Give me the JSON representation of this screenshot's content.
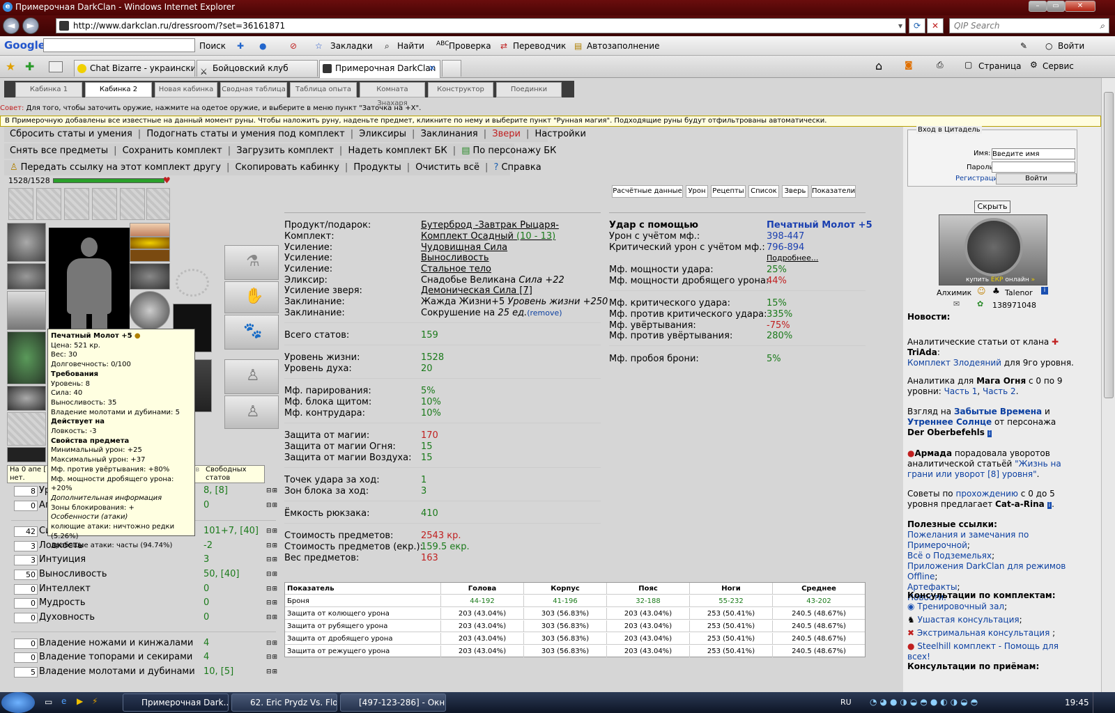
{
  "window": {
    "title": "Примерочная DarkClan - Windows Internet Explorer",
    "url": "http://www.darkclan.ru/dressroom/?set=36161871",
    "search_placeholder": "QIP Search"
  },
  "google_bar": {
    "logo": "Google",
    "search_btn": "Поиск",
    "bookmarks": "Закладки",
    "find": "Найти",
    "check": "Проверка",
    "translate": "Переводчик",
    "autofill": "Автозаполнение",
    "login": "Войти"
  },
  "tabs": [
    {
      "label": "Chat Bizarre - украинский..."
    },
    {
      "label": "Бойцовский клуб"
    },
    {
      "label": "Примерочная DarkClan"
    }
  ],
  "ie_tools": {
    "page": "Страница",
    "service": "Сервис"
  },
  "cab_tabs": [
    "Кабинка 1",
    "Кабинка 2",
    "Новая кабинка",
    "Сводная таблица",
    "Таблица опыта",
    "Комната Знахаря",
    "Конструктор",
    "Поединки"
  ],
  "tip1_label": "Совет:",
  "tip1": "Для того, чтобы заточить оружие, нажмите на одетое оружие, и выберите в меню пункт \"Заточка на +X\".",
  "tip2": "В Примерочную добавлены все известные на данный момент руны. Чтобы наложить руну, наденьте предмет, кликните по нему и выберите пункт \"Рунная магия\". Подходящие руны будут отфильтрованы автоматически.",
  "menu1": [
    "Сбросить статы и умения",
    "Подогнать статы и умения под комплект",
    "Эликсиры",
    "Заклинания",
    "Звери",
    "Настройки"
  ],
  "menu2": [
    "Снять все предметы",
    "Сохранить комплект",
    "Загрузить комплект",
    "Надеть комплект БК",
    "По персонажу БК"
  ],
  "menu3": [
    "Передать ссылку на этот комплект другу",
    "Скопировать кабинку",
    "Продукты",
    "Очистить всё",
    "Справка"
  ],
  "hp": "1528/1528",
  "tooltip": {
    "title": "Печатный Молот +5",
    "price": "Цена: 521 кр.",
    "weight": "Вес: 30",
    "durability": "Долговечность: 0/100",
    "req_h": "Требования",
    "req": [
      "Уровень: 8",
      "Сила: 40",
      "Выносливость: 35",
      "Владение молотами и дубинами: 5"
    ],
    "acts_h": "Действует на",
    "acts": [
      "Ловкость: -3"
    ],
    "props_h": "Свойства предмета",
    "props": [
      "Минимальный урон: +25",
      "Максимальный урон: +37",
      "Мф. против увёртывания: +80%",
      "Мф. мощности дробящего урона: +20%"
    ],
    "extra_h": "Дополнительная информация",
    "extra": [
      "Зоны блокирования: +",
      "Особенности (атаки)",
      "колющие атаки: ничтожно редки (5.26%)",
      "дробящие атаки: часты (94.74%)"
    ]
  },
  "free_line": {
    "left": "На 0 апе [",
    "mid": "статов",
    "right": "Свободных статов",
    "right2": "нет."
  },
  "stats": [
    {
      "box": "8",
      "name": "Ур",
      "val": "8, [8]"
    },
    {
      "box": "0",
      "name": "Ап",
      "val": "0"
    },
    {
      "box": "42",
      "name": "Си",
      "val": "101+7, [40]"
    },
    {
      "box": "3",
      "name": "Ловкость",
      "val": "-2"
    },
    {
      "box": "3",
      "name": "Интуиция",
      "val": "3"
    },
    {
      "box": "50",
      "name": "Выносливость",
      "val": "50, [40]"
    },
    {
      "box": "0",
      "name": "Интеллект",
      "val": "0"
    },
    {
      "box": "0",
      "name": "Мудрость",
      "val": "0"
    },
    {
      "box": "0",
      "name": "Духовность",
      "val": "0"
    },
    {
      "box": "0",
      "name": "Владение ножами и кинжалами",
      "val": "4"
    },
    {
      "box": "0",
      "name": "Владение топорами и секирами",
      "val": "4"
    },
    {
      "box": "5",
      "name": "Владение молотами и дубинами",
      "val": "10, [5]"
    }
  ],
  "info_tabs": [
    "Расчётные данные",
    "Урон",
    "Рецепты",
    "Список",
    "Зверь",
    "Показатели"
  ],
  "info": {
    "food_l": "Продукт/подарок:",
    "food": "Бутерброд -Завтрак Рыцаря-",
    "set_l": "Комплект:",
    "set": "Комплект Осадный",
    "set_range": "(10 - 13)",
    "b1_l": "Усиление:",
    "b1": "Чудовищная Сила",
    "b2_l": "Усиление:",
    "b2": "Выносливость",
    "b3_l": "Усиление:",
    "b3": "Стальное тело",
    "el_l": "Эликсир:",
    "el": "Снадобье Великана",
    "el_it": "Сила +22",
    "beast_l": "Усиление зверя:",
    "beast": "Демоническая Сила [7]",
    "sp1_l": "Заклинание:",
    "sp1": "Жажда Жизни+5",
    "sp1_it": "Уровень жизни +250",
    "sp2_l": "Заклинание:",
    "sp2": "Сокрушение на",
    "sp2_it": "25 ед.",
    "remove": "(remove)",
    "total_l": "Всего статов:",
    "total": "159",
    "hp_l": "Уровень жизни:",
    "hp": "1528",
    "sp_l": "Уровень духа:",
    "sp": "20",
    "par_l": "Мф. парирования:",
    "par": "5%",
    "shield_l": "Мф. блока щитом:",
    "shield": "10%",
    "counter_l": "Мф. контрудара:",
    "counter": "10%",
    "mag_l": "Защита от магии:",
    "mag": "170",
    "fire_l": "Защита от магии Огня:",
    "fire": "15",
    "air_l": "Защита от магии Воздуха:",
    "air": "15",
    "hits_l": "Точек удара за ход:",
    "hits": "1",
    "blocks_l": "Зон блока за ход:",
    "blocks": "3",
    "bag_l": "Ёмкость рюкзака:",
    "bag": "410",
    "cost_l": "Стоимость предметов:",
    "cost": "2543 кр.",
    "ecost_l": "Стоимость предметов (екр.):",
    "ecost": "159.5 екр.",
    "wt_l": "Вес предметов:",
    "wt": "163"
  },
  "hit": {
    "head_l": "Удар с помощью",
    "head": "Печатный Молот +5",
    "dmg_l": "Урон с учётом мф.:",
    "dmg": "398-447",
    "crit_l": "Критический урон с учётом мф.:",
    "crit": "796-894",
    "more": "Подробнее...",
    "pw_l": "Мф. мощности удара:",
    "pw": "25%",
    "crush_l": "Мф. мощности дробящего урона:",
    "crush": "44%",
    "cr_l": "Мф. критического удара:",
    "cr": "15%",
    "acr_l": "Мф. против критического удара:",
    "acr": "335%",
    "dodge_l": "Мф. увёртывания:",
    "dodge": "-75%",
    "adodge_l": "Мф. против увёртывания:",
    "adodge": "280%",
    "pierce_l": "Мф. пробоя брони:",
    "pierce": "5%"
  },
  "table": {
    "headers": [
      "Показатель",
      "Голова",
      "Корпус",
      "Пояс",
      "Ноги",
      "Среднее"
    ],
    "rows": [
      [
        "Броня",
        "44-192",
        "41-196",
        "32-188",
        "55-232",
        "43-202"
      ],
      [
        "Защита от колющего урона",
        "203 (43.04%)",
        "303 (56.83%)",
        "203 (43.04%)",
        "253 (50.41%)",
        "240.5 (48.67%)"
      ],
      [
        "Защита от рубящего урона",
        "203 (43.04%)",
        "303 (56.83%)",
        "203 (43.04%)",
        "253 (50.41%)",
        "240.5 (48.67%)"
      ],
      [
        "Защита от дробящего урона",
        "203 (43.04%)",
        "303 (56.83%)",
        "203 (43.04%)",
        "253 (50.41%)",
        "240.5 (48.67%)"
      ],
      [
        "Защита от режущего урона",
        "203 (43.04%)",
        "303 (56.83%)",
        "203 (43.04%)",
        "253 (50.41%)",
        "240.5 (48.67%)"
      ]
    ]
  },
  "login": {
    "title": "Вход в Цитадель",
    "name_l": "Имя:",
    "name_ph": "Введите имя",
    "pass_l": "Пароль:",
    "reg": "Регистрация",
    "enter": "Войти",
    "hide": "Скрыть"
  },
  "banner": {
    "buy": "купить",
    "ekr": "ЕКР",
    "online": "онлайн"
  },
  "players": {
    "p1": "Алхимик",
    "p2": "Talenor",
    "id": "138971048"
  },
  "news": {
    "h": "Новости:",
    "n1a": "Аналитические статьи от клана",
    "n1b": "TriAda",
    "n1c": "Комплект Злодеяний",
    "n1d": "для 9го уровня.",
    "n2a": "Аналитика для",
    "n2b": "Мага Огня",
    "n2c": "с 0 по 9 уровни:",
    "n2d": "Часть 1",
    "n2e": "Часть 2",
    "n3a": "Взгляд на",
    "n3b": "Забытые Времена",
    "n3c": "и",
    "n3d": "Утреннее Солнце",
    "n3e": "от персонажа",
    "n3f": "Der Oberbefehls",
    "n4a": "Армада",
    "n4b": "порадовала уворотов аналитической статьёй",
    "n4c": "\"Жизнь на грани или уворот [8] уровня\"",
    "n5a": "Советы по",
    "n5b": "прохождению",
    "n5c": "с 0 до 5 уровня предлагает",
    "n5d": "Cat-a-Rina",
    "useful": "Полезные ссылки:",
    "u1": "Пожелания и замечания по Примерочной",
    "u2": "Всё о Подземельях",
    "u3": "Приложения DarkClan для режимов Offline",
    "u4": "Артефакты",
    "u5": "Новости.",
    "cons": "Консультации по комплектам:",
    "c1": "Тренировочный зал",
    "c2": "Ушастая консультация",
    "c3": "Экстримальная консультация",
    "c4": "Steelhill комплект - Помощь для всех!",
    "cons2": "Консультации по приёмам:"
  },
  "taskbar": {
    "t1": "Примерочная Dark...",
    "t2": "62. Eric Prydz Vs. Flo...",
    "t3": "[497-123-286] - Окн...",
    "lang": "RU",
    "time": "19:45"
  }
}
